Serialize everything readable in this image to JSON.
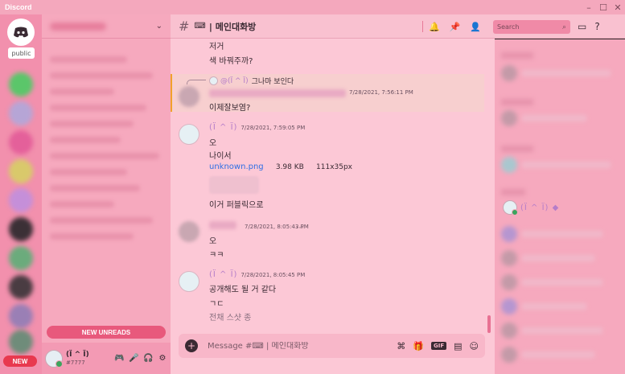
{
  "window": {
    "app_title": "Discord",
    "controls": [
      "–",
      "☐",
      "✕"
    ]
  },
  "rail": {
    "public_label": "public",
    "new_badge": "NEW"
  },
  "sidebar": {
    "new_unreads": "NEW UNREADS"
  },
  "user": {
    "name": "(Ï ^ Ï)",
    "tag": "#7777"
  },
  "channel": {
    "name": "메인대화방",
    "icon": "keyboard-icon"
  },
  "search": {
    "placeholder": "Search"
  },
  "messages": {
    "m0_line1": "저거",
    "m0_line2": "색 바꿔주까?",
    "reply": {
      "name": "@(Ï ^ Ï)",
      "text": "그나마 보인다"
    },
    "m1_timestamp": "7/28/2021, 7:56:11 PM",
    "m1_text": "이제잘보염?",
    "m2": {
      "author": "(Ï ^ Ï)",
      "timestamp": "7/28/2021, 7:59:05 PM",
      "line1": "오",
      "line2": "나이서",
      "file_name": "unknown.png",
      "file_size": "3.98 KB",
      "file_dims": "111x35px",
      "line3": "이거 퍼블릭으로"
    },
    "m3": {
      "timestamp": "7/28/2021, 8:05:43 PM",
      "line1": "오",
      "line2": "ㅋㅋ"
    },
    "m4": {
      "author": "(Ï ^ Ï)",
      "timestamp": "7/28/2021, 8:05:45 PM",
      "line1": "공개해도 될 거 같다",
      "line2": "ㄱㄷ",
      "line3": "전채 스샷 종"
    }
  },
  "composer": {
    "placeholder": "Message #⌨ | 메인대화방",
    "gif_label": "GIF"
  },
  "members": {
    "me_name": "(Ï ^ Ï) ◆"
  },
  "colors": {
    "accent": "#f6a9be",
    "mention": "#b57dc9",
    "link": "#2f6fe4",
    "online": "#3ba55d",
    "new_badge": "#e8394f"
  }
}
